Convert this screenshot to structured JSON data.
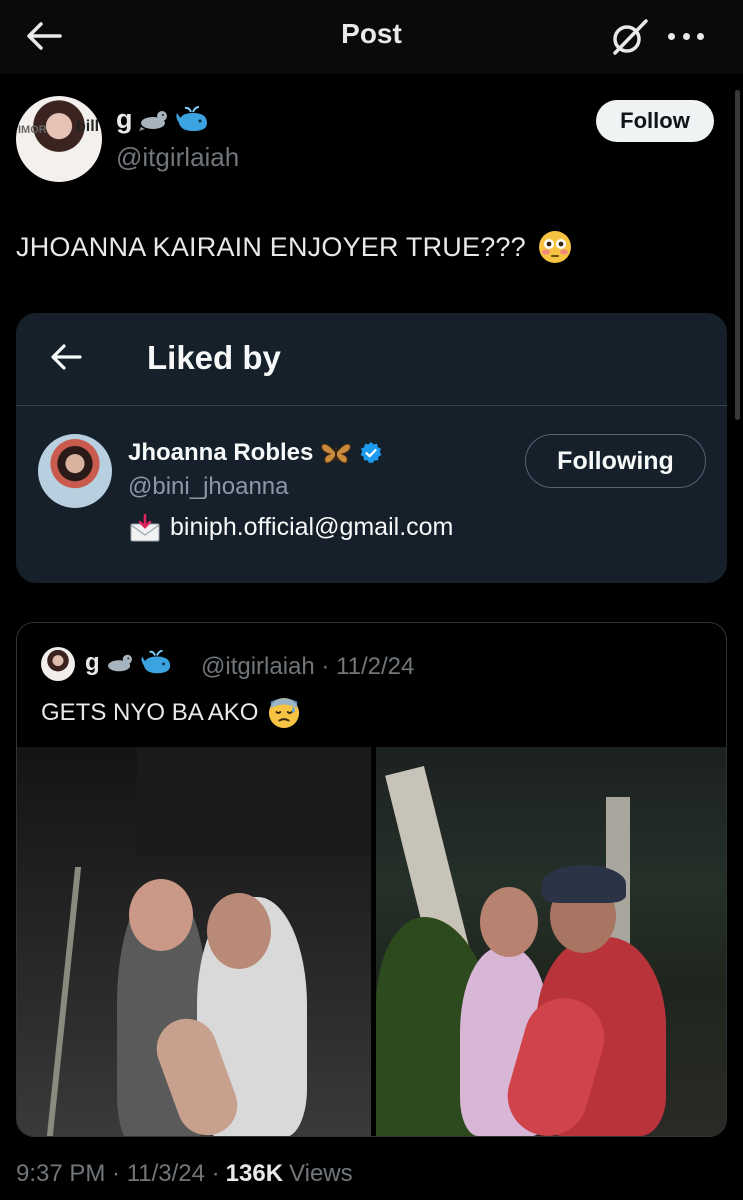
{
  "header": {
    "title": "Post"
  },
  "post": {
    "author_name": "g",
    "author_handle": "@itgirlaiah",
    "follow_label": "Follow",
    "text": "JHOANNA KAIRAIN ENJOYER TRUE???",
    "avatar_logo_left": "IMOR",
    "avatar_logo_right": "bill",
    "timestamp": "9:37 PM · 11/3/24 ·",
    "views_count": "136K",
    "views_label": "Views"
  },
  "liked_by": {
    "title": "Liked by",
    "user_name": "Jhoanna Robles",
    "user_handle": "@bini_jhoanna",
    "bio": "biniph.official@gmail.com",
    "following_label": "Following"
  },
  "quoted": {
    "author_name": "g",
    "meta": "@itgirlaiah · 11/2/24",
    "text": "GETS NYO BA AKO"
  },
  "icons": {
    "back": "arrow-left-icon",
    "grok": "grok-icon",
    "more": "more-icon",
    "seal": "seal-emoji-icon",
    "whale": "whale-emoji-icon",
    "flushed": "flushed-face-emoji-icon",
    "butterfly": "butterfly-emoji-icon",
    "verified": "verified-badge-icon",
    "envelope": "envelope-arrow-icon",
    "downcast": "downcast-sweat-face-emoji-icon"
  },
  "colors": {
    "background": "#000000",
    "card": "#15202b",
    "verified": "#1d9bf0",
    "muted": "#71767b"
  }
}
